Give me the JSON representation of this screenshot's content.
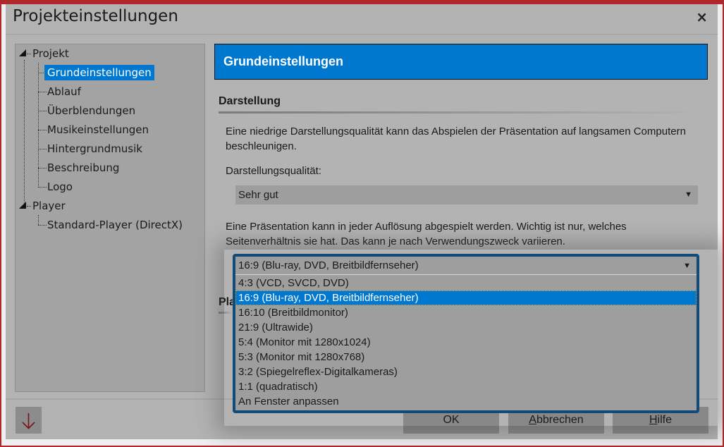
{
  "window": {
    "title": "Projekteinstellungen",
    "close_label": "×"
  },
  "tree": {
    "groups": [
      {
        "label": "Projekt",
        "children": [
          {
            "label": "Grundeinstellungen",
            "selected": true
          },
          {
            "label": "Ablauf"
          },
          {
            "label": "Überblendungen"
          },
          {
            "label": "Musikeinstellungen"
          },
          {
            "label": "Hintergrundmusik"
          },
          {
            "label": "Beschreibung"
          },
          {
            "label": "Logo"
          }
        ]
      },
      {
        "label": "Player",
        "children": [
          {
            "label": "Standard-Player (DirectX)"
          }
        ]
      }
    ]
  },
  "panel": {
    "header": "Grundeinstellungen",
    "section_darstellung": "Darstellung",
    "quality_description": "Eine niedrige Darstellungsqualität kann das Abspielen der Präsentation auf langsamen Computern beschleunigen.",
    "quality_label": "Darstellungsqualität:",
    "quality_value": "Sehr gut",
    "ratio_description": "Eine Präsentation kann in jeder Auflösung abgespielt werden. Wichtig ist nur, welches Seitenverhältnis sie hat. Das kann je nach Verwendungszweck variieren.",
    "hidden_section_partial": "Pla",
    "ratio_dropdown": {
      "current": "16:9 (Blu-ray, DVD, Breitbildfernseher)",
      "options": [
        "4:3 (VCD, SVCD, DVD)",
        "16:9 (Blu-ray, DVD, Breitbildfernseher)",
        "16:10 (Breitbildmonitor)",
        "21:9 (Ultrawide)",
        "5:4 (Monitor mit 1280x1024)",
        "5:3 (Monitor mit 1280x768)",
        "3:2 (Spiegelreflex-Digitalkameras)",
        "1:1 (quadratisch)",
        "An Fenster anpassen"
      ],
      "selected_index": 1
    }
  },
  "footer": {
    "down_icon": "arrow-down-icon",
    "ok": "OK",
    "cancel_mnemonic": "A",
    "cancel_rest": "bbrechen",
    "help_mnemonic": "H",
    "help_rest": "ilfe"
  },
  "colors": {
    "accent": "#0078d0",
    "frame_border": "#b0282c",
    "dropdown_border": "#124a78",
    "background": "#b3b3b3"
  }
}
